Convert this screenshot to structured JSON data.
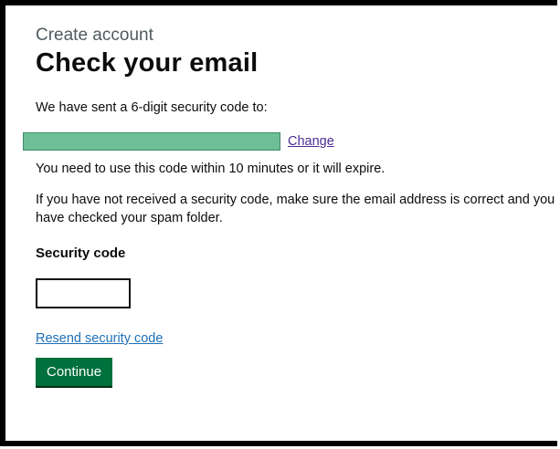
{
  "header": {
    "caption": "Create account",
    "title": "Check your email"
  },
  "main": {
    "sent_text": "We have sent a 6-digit security code to:",
    "change_link": "Change",
    "expire_text": "You need to use this code within 10 minutes or it will expire.",
    "spam_text": "If you have not received a security code, make sure the email address is correct and you have checked your spam folder.",
    "security_code_label": "Security code",
    "security_code_value": "",
    "resend_link": "Resend security code",
    "continue_button": "Continue"
  },
  "colors": {
    "redaction": "#6dbf96",
    "link": "#4c2c92",
    "resend_link": "#1d70b8",
    "button": "#00703c"
  }
}
